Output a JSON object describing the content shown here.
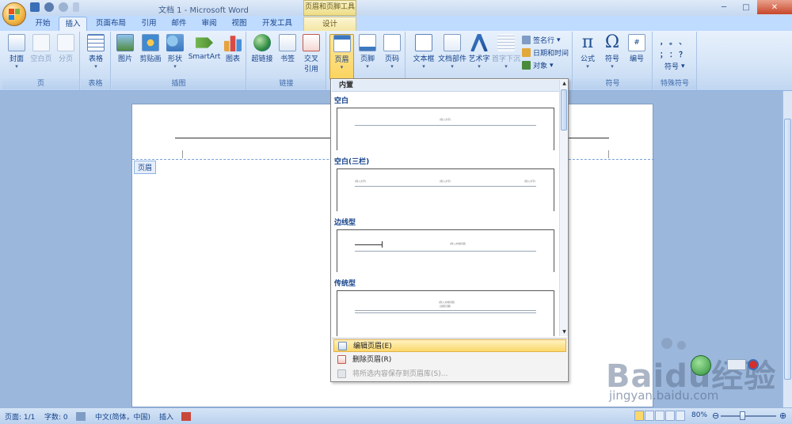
{
  "window": {
    "title": "文档 1 - Microsoft Word",
    "context_title": "页眉和页脚工具",
    "min": "─",
    "max": "□",
    "close": "✕"
  },
  "tabs": [
    {
      "label": "开始"
    },
    {
      "label": "插入",
      "active": true
    },
    {
      "label": "页面布局"
    },
    {
      "label": "引用"
    },
    {
      "label": "邮件"
    },
    {
      "label": "审阅"
    },
    {
      "label": "视图"
    },
    {
      "label": "开发工具"
    },
    {
      "label": "设计",
      "contextual": true
    }
  ],
  "ribbon": {
    "groups": {
      "page": "页",
      "table": "表格",
      "illustrations": "插图",
      "links": "链接",
      "symbols": "符号",
      "special": "特殊符号"
    },
    "buttons": {
      "cover": "封面",
      "blank_page": "空白页",
      "page_break": "分页",
      "table": "表格",
      "picture": "图片",
      "clip_art": "剪贴画",
      "shapes": "形状",
      "smartart": "SmartArt",
      "chart": "图表",
      "hyperlink": "超链接",
      "bookmark": "书签",
      "cross_ref_1": "交叉",
      "cross_ref_2": "引用",
      "header": "页眉",
      "footer": "页脚",
      "page_number": "页码",
      "text_box": "文本框",
      "quick_parts": "文档部件",
      "word_art": "艺术字",
      "drop_cap": "首字下沉",
      "equation": "公式",
      "symbol": "符号",
      "number": "编号",
      "special_symbol": "符号"
    },
    "small": {
      "signature": "签名行",
      "datetime": "日期和时间",
      "object": "对象"
    },
    "special_chars": {
      "row1": "，  。  、",
      "row2": "；  ：  ？"
    }
  },
  "document": {
    "header_tag": "页眉"
  },
  "gallery": {
    "heading": "内置",
    "sections": [
      {
        "name": "空白",
        "sample": "[键入文字]"
      },
      {
        "name": "空白(三栏)",
        "sample": "[键入文字]"
      },
      {
        "name": "边线型",
        "sample": "[键入文档标题]"
      },
      {
        "name": "传统型",
        "sample": "[键入文档标题]"
      }
    ],
    "sample_date": "[选取日期]",
    "footer_items": [
      {
        "label": "编辑页眉(E)",
        "highlighted": true
      },
      {
        "label": "删除页眉(R)"
      },
      {
        "label": "将所选内容保存到页眉库(S)...",
        "disabled": true
      }
    ]
  },
  "statusbar": {
    "page": "页面: 1/1",
    "words": "字数: 0",
    "language": "中文(简体，中国)",
    "mode": "插入",
    "zoom": "80%",
    "zoom_value": 0.8
  },
  "watermark": {
    "brand": "Baidu经验",
    "url": "jingyan.baidu.com"
  },
  "colors": {
    "ribbon_text": "#15428b",
    "highlight": "#fbd86b",
    "accent_blue": "#8db2e3"
  }
}
